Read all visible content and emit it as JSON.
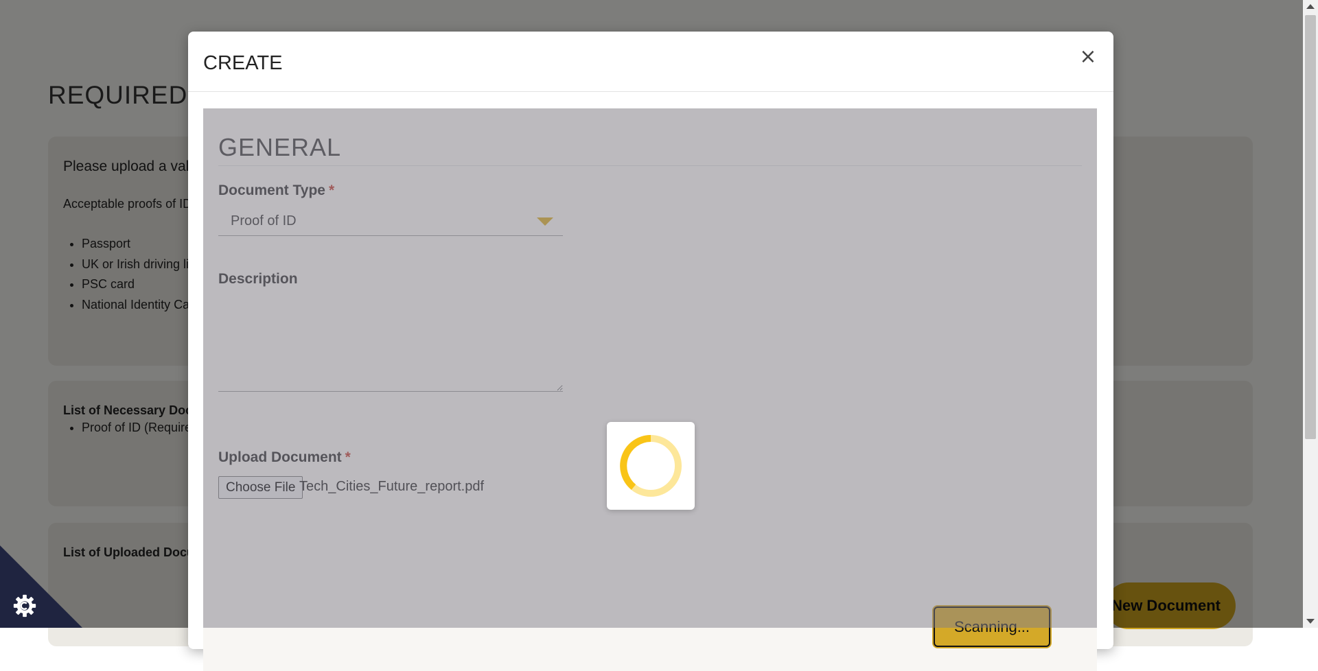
{
  "background": {
    "page_title": "REQUIRED DOCUMENTS",
    "upload_card": {
      "intro": "Please upload a valid proof of ID",
      "acceptable_label": "Acceptable proofs of ID:",
      "items": [
        "Passport",
        "UK or Irish driving licence",
        "PSC card",
        "National Identity Card"
      ]
    },
    "necessary_card": {
      "heading": "List of Necessary Documents",
      "items": [
        "Proof of ID (Required)"
      ]
    },
    "uploaded_card": {
      "heading": "List of Uploaded Documents"
    },
    "new_document_label": "New Document"
  },
  "modal": {
    "title": "CREATE",
    "close_label": "×",
    "section_title": "GENERAL",
    "document_type": {
      "label": "Document Type",
      "required_mark": "*",
      "value": "Proof of ID"
    },
    "description": {
      "label": "Description",
      "value": ""
    },
    "upload": {
      "label": "Upload Document",
      "required_mark": "*",
      "choose_label": "Choose File",
      "file_name": "Tech_Cities_Future_report.pdf"
    },
    "submit_label": "Scanning..."
  },
  "colors": {
    "accent": "#d4a928",
    "required": "#c0392b",
    "cookie_corner": "#1f2440",
    "spinner_track": "#fde79a",
    "spinner_arc": "#f9c417"
  },
  "icons": [
    "close-icon",
    "chevron-down-icon",
    "cookie-settings-icon",
    "loading-spinner-icon"
  ]
}
